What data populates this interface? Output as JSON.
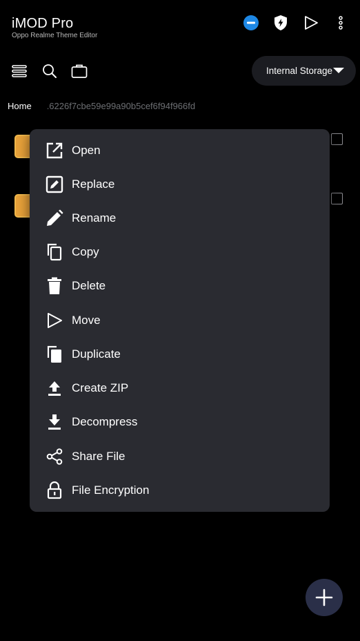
{
  "app": {
    "title": "iMOD Pro",
    "subtitle": "Oppo Realme Theme Editor"
  },
  "topbar_icons": [
    "minus-circle-icon",
    "shield-bolt-icon",
    "play-icon",
    "more-vert-icon"
  ],
  "toolbar": {
    "icons": [
      "menu-lines-icon",
      "search-icon",
      "briefcase-icon"
    ],
    "storage_label": "Internal Storage"
  },
  "breadcrumb": {
    "home": "Home",
    "path": ".6226f7cbe59e99a90b5cef6f94f966fd"
  },
  "context_menu": {
    "items": [
      {
        "label": "Open",
        "icon": "open-external-icon"
      },
      {
        "label": "Replace",
        "icon": "replace-edit-icon"
      },
      {
        "label": "Rename",
        "icon": "pencil-icon"
      },
      {
        "label": "Copy",
        "icon": "copy-icon"
      },
      {
        "label": "Delete",
        "icon": "trash-icon"
      },
      {
        "label": "Move",
        "icon": "move-arrow-icon"
      },
      {
        "label": "Duplicate",
        "icon": "duplicate-icon"
      },
      {
        "label": "Create ZIP",
        "icon": "upload-icon"
      },
      {
        "label": "Decompress",
        "icon": "download-icon"
      },
      {
        "label": "Share File",
        "icon": "share-icon"
      },
      {
        "label": "File Encryption",
        "icon": "lock-icon"
      }
    ]
  },
  "colors": {
    "background": "#000000",
    "menu_background": "#2a2b31",
    "accent_blue": "#1e88e5",
    "fab_background": "#2a2f48",
    "folder": "#e8a23a"
  }
}
